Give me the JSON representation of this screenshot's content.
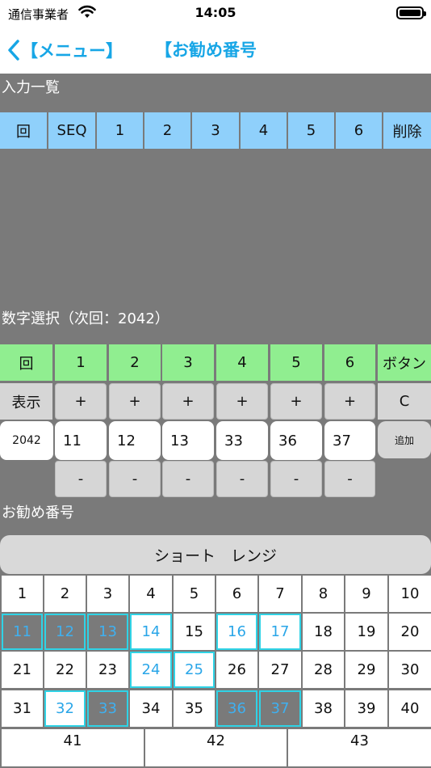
{
  "status_bar": {
    "carrier": "通信事業者",
    "time": "14:05"
  },
  "nav": {
    "back_label": "【メニュー】",
    "title": "【お勧め番号"
  },
  "input_list": {
    "label": "入力一覧",
    "headers": [
      "回",
      "SEQ",
      "1",
      "2",
      "3",
      "4",
      "5",
      "6",
      "削除"
    ]
  },
  "number_select": {
    "label": "数字選択（次回：2042）",
    "headers": [
      "回",
      "1",
      "2",
      "3",
      "4",
      "5",
      "6",
      "ボタン"
    ],
    "show_label": "表示",
    "plus": "+",
    "minus": "-",
    "clear_label": "C",
    "round_value": "2042",
    "values": [
      "11",
      "12",
      "13",
      "33",
      "36",
      "37"
    ],
    "add_label": "追加"
  },
  "recommend": {
    "label": "お勧め番号",
    "range_button": "ショート　レンジ",
    "rows": [
      [
        "1",
        "2",
        "3",
        "4",
        "5",
        "6",
        "7",
        "8",
        "9",
        "10"
      ],
      [
        "11",
        "12",
        "13",
        "14",
        "15",
        "16",
        "17",
        "18",
        "19",
        "20"
      ],
      [
        "21",
        "22",
        "23",
        "24",
        "25",
        "26",
        "27",
        "28",
        "29",
        "30"
      ],
      [
        "31",
        "32",
        "33",
        "34",
        "35",
        "36",
        "37",
        "38",
        "39",
        "40"
      ]
    ],
    "last_row": [
      "41",
      "42",
      "43"
    ],
    "selected_numbers": [
      "11",
      "12",
      "13",
      "14",
      "16",
      "17",
      "24",
      "25",
      "32",
      "33",
      "36",
      "37"
    ],
    "dark_numbers": [
      "11",
      "12",
      "13",
      "33",
      "36",
      "37"
    ]
  }
}
